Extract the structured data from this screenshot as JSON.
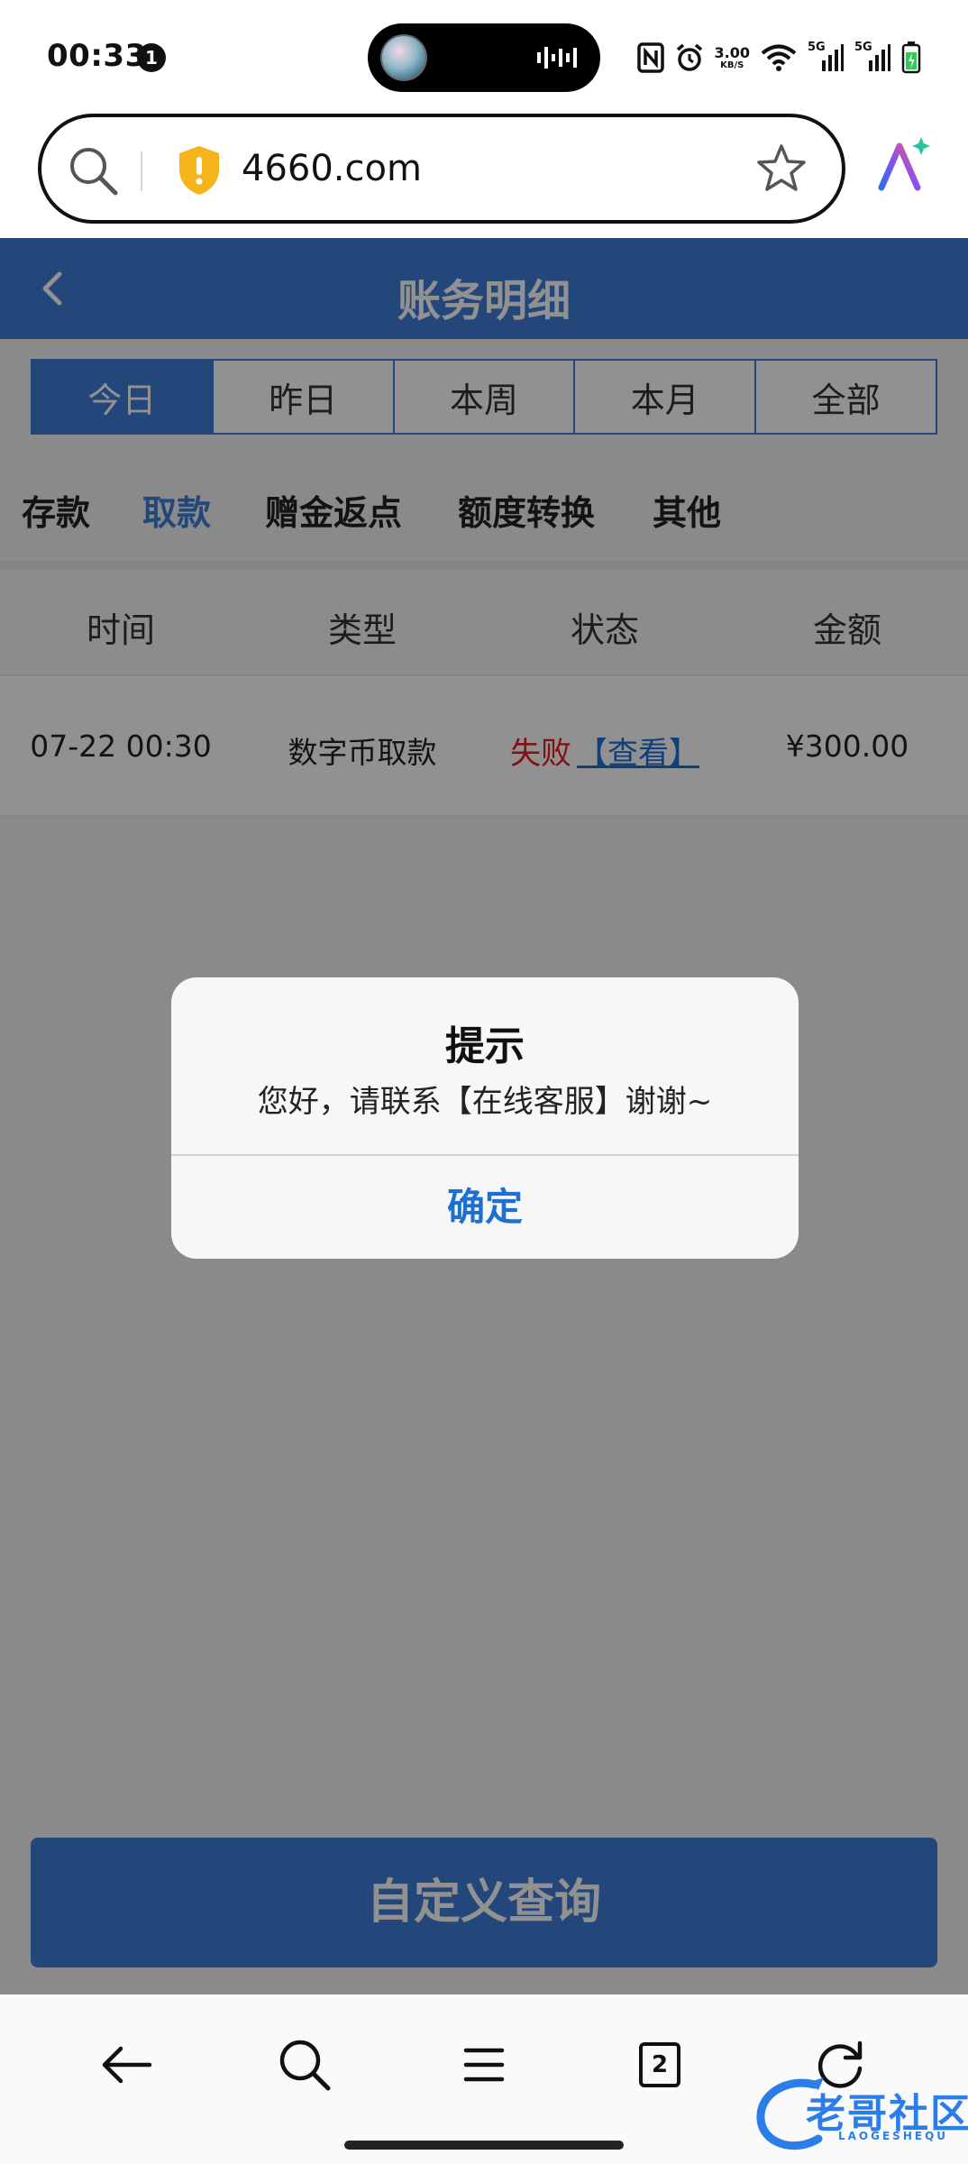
{
  "status_bar": {
    "time": "00:33",
    "notification_count": "1",
    "net_speed_value": "3.00",
    "net_speed_unit": "KB/S",
    "sim1_label": "5G",
    "sim2_label": "5G",
    "icons": [
      "nfc-icon",
      "alarm-icon",
      "wifi-icon",
      "signal-icon",
      "signal-icon",
      "battery-icon"
    ]
  },
  "browser": {
    "url": "4660.com",
    "icons": [
      "search-icon",
      "security-shield-icon",
      "bookmark-star-icon",
      "ai-assistant-icon"
    ]
  },
  "header": {
    "title": "账务明细",
    "back_icon": "chevron-left-icon"
  },
  "date_tabs": {
    "items": [
      "今日",
      "昨日",
      "本周",
      "本月",
      "全部"
    ],
    "active_index": 0
  },
  "type_tabs": {
    "items": [
      "存款",
      "取款",
      "赠金返点",
      "额度转换",
      "其他"
    ],
    "active_index": 1
  },
  "table": {
    "columns": [
      "时间",
      "类型",
      "状态",
      "金额"
    ],
    "rows": [
      {
        "time": "07-22 00:30",
        "type": "数字币取款",
        "status": "失败",
        "status_action": "【查看】",
        "amount": "¥300.00"
      }
    ]
  },
  "query_button": {
    "label": "自定义查询"
  },
  "dialog": {
    "title": "提示",
    "message": "您好，请联系【在线客服】谢谢~",
    "confirm_label": "确定"
  },
  "bottom_nav": {
    "tab_count": "2",
    "icons": [
      "back-arrow-icon",
      "search-icon",
      "menu-icon",
      "tabs-icon",
      "refresh-icon"
    ]
  },
  "watermark": {
    "text": "老哥社区",
    "subtext": "LAOGESHEQU"
  },
  "colors": {
    "brand_blue": "#3e7ed9",
    "link_blue": "#1f6fd1",
    "fail_red": "#e02020",
    "overlay": "rgba(0,0,0,0.43)"
  }
}
